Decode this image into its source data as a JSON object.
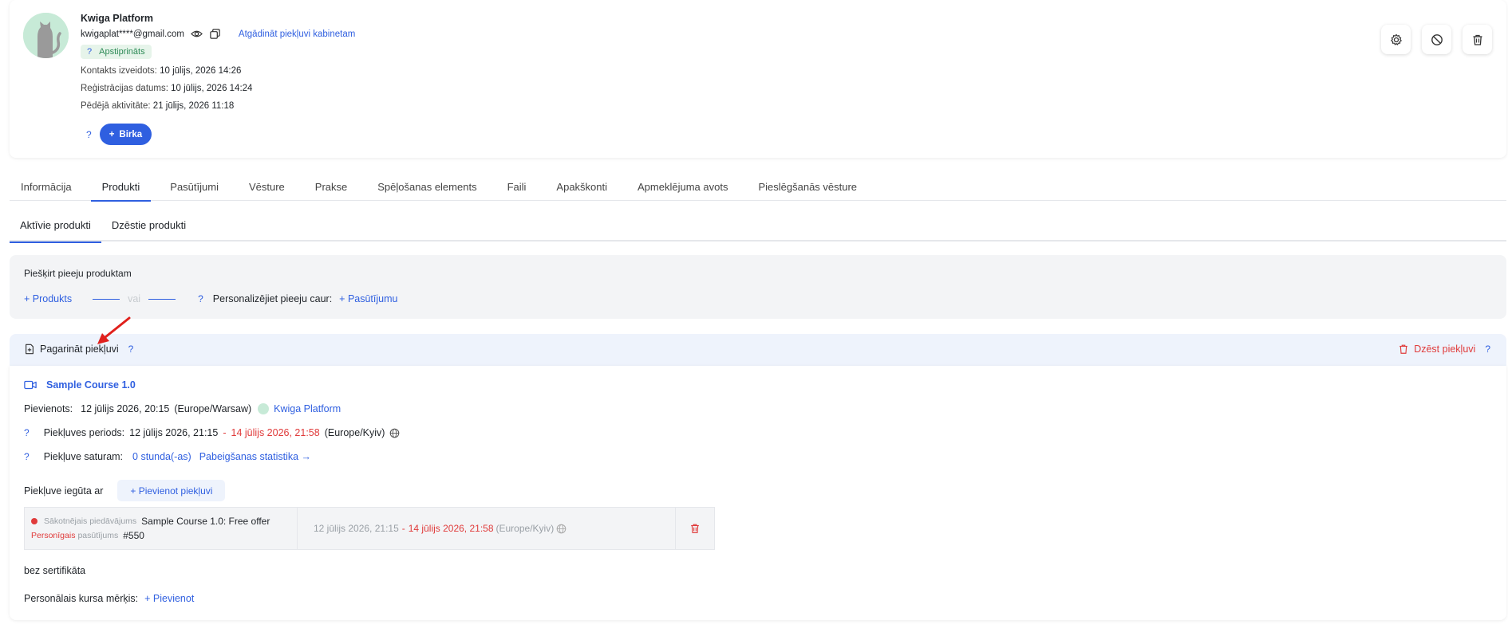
{
  "profile": {
    "name": "Kwiga Platform",
    "email": "kwigaplat****@gmail.com",
    "remind_link": "Atgādināt piekļuvi kabinetam",
    "badge_q": "?",
    "badge_label": "Apstiprināts",
    "meta": [
      {
        "label": "Kontakts izveidots:",
        "value": "10 jūlijs, 2026 14:26"
      },
      {
        "label": "Reģistrācijas datums:",
        "value": "10 jūlijs, 2026 14:24"
      },
      {
        "label": "Pēdējā aktivitāte:",
        "value": "21 jūlijs, 2026 11:18"
      }
    ],
    "tag_q": "?",
    "tag_button": "Birka",
    "tag_plus": "+"
  },
  "tabs": [
    {
      "label": "Informācija"
    },
    {
      "label": "Produkti"
    },
    {
      "label": "Pasūtījumi"
    },
    {
      "label": "Vēsture"
    },
    {
      "label": "Prakse"
    },
    {
      "label": "Spēļošanas elements"
    },
    {
      "label": "Faili"
    },
    {
      "label": "Apakškonti"
    },
    {
      "label": "Apmeklējuma avots"
    },
    {
      "label": "Pieslēgšanās vēsture"
    }
  ],
  "subtabs": [
    {
      "label": "Aktīvie produkti"
    },
    {
      "label": "Dzēstie produkti"
    }
  ],
  "grant": {
    "title": "Piešķirt pieeju produktam",
    "add_product": "+ Produkts",
    "or": "vai",
    "q": "?",
    "personalize": "Personalizējiet pieeju caur:",
    "add_order": "+ Pasūtījumu"
  },
  "extend": {
    "title": "Pagarināt piekļuvi",
    "q": "?",
    "delete_label": "Dzēst piekļuvi",
    "delete_q": "?",
    "course_title": "Sample Course 1.0",
    "joined_label": "Pievienots:",
    "joined_value": "12 jūlijs 2026, 20:15",
    "joined_tz": "(Europe/Warsaw)",
    "joined_by": "Kwiga Platform",
    "period_q": "?",
    "period_label": "Piekļuves periods:",
    "period_start": "12 jūlijs 2026, 21:15",
    "period_sep": "-",
    "period_end": "14 jūlijs 2026, 21:58",
    "period_tz": "(Europe/Kyiv)",
    "content_q": "?",
    "content_label": "Piekļuve saturam:",
    "content_hours": "0 stunda(-as)",
    "stats_link": "Pabeigšanas statistika →",
    "obtained_label": "Piekļuve iegūta ar",
    "add_access": "+ Pievienot piekļuvi",
    "offer": {
      "initial_label": "Sākotnējais piedāvājums",
      "offer_name": "Sample Course 1.0: Free offer",
      "personal_label": "Personīgais",
      "order_label": "pasūtījums",
      "order_no": "#550",
      "start": "12 jūlijs 2026, 21:15",
      "sep": "-",
      "end": "14 jūlijs 2026, 21:58",
      "tz": "(Europe/Kyiv)"
    },
    "certificate": "bez sertifikāta",
    "goal_label": "Personālais kursa mērķis:",
    "goal_add": "+ Pievienot"
  },
  "colors": {
    "accent": "#2f5fe0",
    "danger": "#e03b3b",
    "success_bg": "#e6f4ea",
    "success_text": "#2e8b57",
    "annotation_arrow": "#e0201c"
  }
}
